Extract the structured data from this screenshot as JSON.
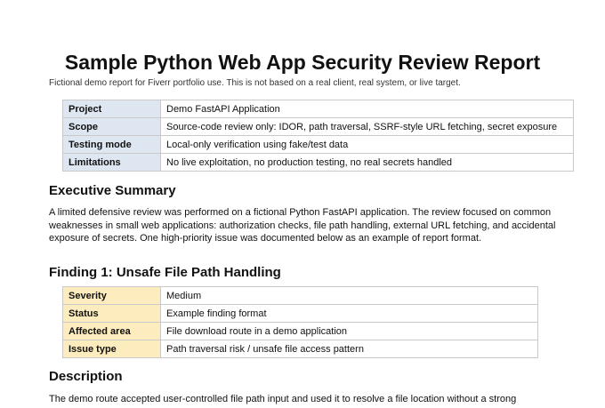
{
  "title": "Sample Python Web App Security Review Report",
  "subtitle": "Fictional demo report for Fiverr portfolio use. This is not based on a real client, real system, or live target.",
  "overview": [
    {
      "key": "Project",
      "value": "Demo FastAPI Application"
    },
    {
      "key": "Scope",
      "value": "Source-code review only: IDOR, path traversal, SSRF-style URL fetching, secret exposure"
    },
    {
      "key": "Testing mode",
      "value": "Local-only verification using fake/test data"
    },
    {
      "key": "Limitations",
      "value": "No live exploitation, no production testing, no real secrets handled"
    }
  ],
  "executive_summary": {
    "heading": "Executive Summary",
    "text": "A limited defensive review was performed on a fictional Python FastAPI application. The review focused on common weaknesses in small web applications: authorization checks, file path handling, external URL fetching, and accidental exposure of secrets. One high-priority issue was documented below as an example of report format."
  },
  "finding": {
    "heading": "Finding 1: Unsafe File Path Handling",
    "rows": [
      {
        "key": "Severity",
        "value": "Medium"
      },
      {
        "key": "Status",
        "value": "Example finding format"
      },
      {
        "key": "Affected area",
        "value": "File download route in a demo application"
      },
      {
        "key": "Issue type",
        "value": "Path traversal risk / unsafe file access pattern"
      }
    ]
  },
  "description": {
    "heading": "Description",
    "text": "The demo route accepted user-controlled file path input and used it to resolve a file location without a strong"
  },
  "colors": {
    "overview_key_bg": "#dde6f1",
    "finding_key_bg": "#fdecbe",
    "border": "#c9c9c9"
  }
}
